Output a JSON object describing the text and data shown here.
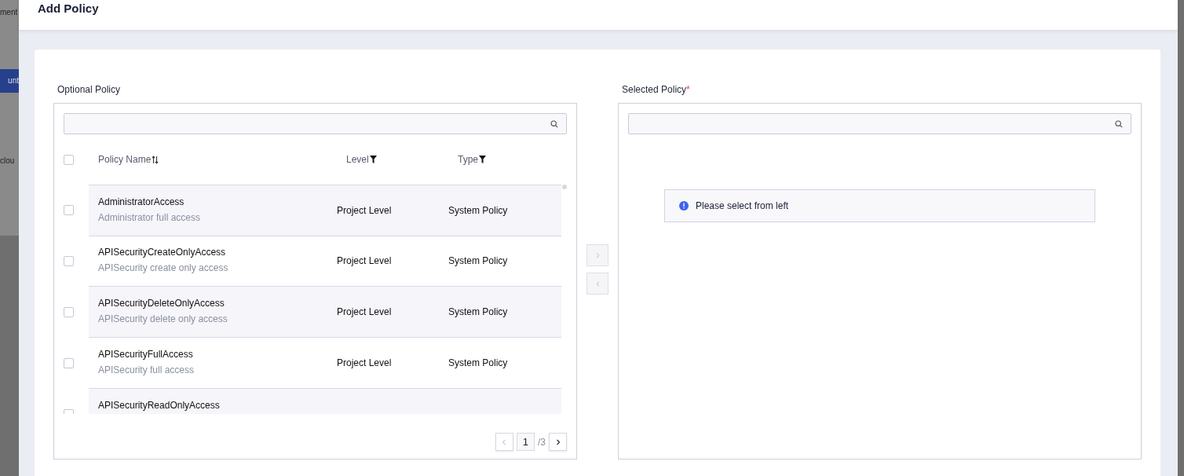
{
  "background_page": {
    "texts": [
      "ment",
      "unt",
      "clou"
    ]
  },
  "dialog": {
    "title": "Add Policy"
  },
  "optional_policy": {
    "label": "Optional Policy",
    "table": {
      "select_all_checked": false,
      "columns": [
        {
          "label": "Policy Name",
          "kind": "sort"
        },
        {
          "label": "Level",
          "kind": "filter"
        },
        {
          "label": "Type",
          "kind": "filter"
        }
      ],
      "rows": [
        {
          "name": "AdministratorAccess",
          "description": "Administrator full access",
          "level": "Project Level",
          "type": "System Policy",
          "checked": false
        },
        {
          "name": "APISecurityCreateOnlyAccess",
          "description": "APISecurity create only access",
          "level": "Project Level",
          "type": "System Policy",
          "checked": false
        },
        {
          "name": "APISecurityDeleteOnlyAccess",
          "description": "APISecurity delete only access",
          "level": "Project Level",
          "type": "System Policy",
          "checked": false
        },
        {
          "name": "APISecurityFullAccess",
          "description": "APISecurity full access",
          "level": "Project Level",
          "type": "System Policy",
          "checked": false
        },
        {
          "name": "APISecurityReadOnlyAccess",
          "checked": false
        }
      ]
    },
    "pagination": {
      "current": "1",
      "total": "/3",
      "prev_disabled": true,
      "next_disabled": false
    }
  },
  "selected_policy": {
    "label": "Selected Policy",
    "required": true,
    "required_mark": "*",
    "empty_message": "Please select from left"
  }
}
